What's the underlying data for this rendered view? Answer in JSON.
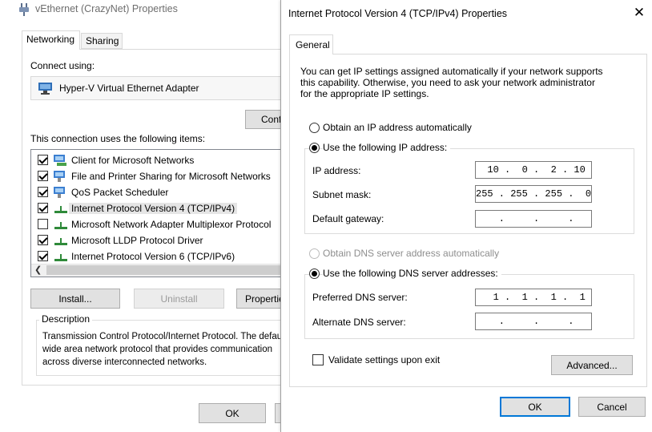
{
  "back_window": {
    "title": "vEthernet (CrazyNet) Properties",
    "tabs": [
      "Networking",
      "Sharing"
    ],
    "connect_using_label": "Connect using:",
    "adapter_name": "Hyper-V Virtual Ethernet Adapter",
    "configure_button": "Configure...",
    "items_label": "This connection uses the following items:",
    "items": [
      {
        "label": "Client for Microsoft Networks",
        "checked": true,
        "icon": "network-client-icon"
      },
      {
        "label": "File and Printer Sharing for Microsoft Networks",
        "checked": true,
        "icon": "network-service-icon"
      },
      {
        "label": "QoS Packet Scheduler",
        "checked": true,
        "icon": "network-service-icon"
      },
      {
        "label": "Internet Protocol Version 4 (TCP/IPv4)",
        "checked": true,
        "icon": "protocol-icon",
        "selected": true
      },
      {
        "label": "Microsoft Network Adapter Multiplexor Protocol",
        "checked": false,
        "icon": "protocol-icon"
      },
      {
        "label": "Microsoft LLDP Protocol Driver",
        "checked": true,
        "icon": "protocol-icon"
      },
      {
        "label": "Internet Protocol Version 6 (TCP/IPv6)",
        "checked": true,
        "icon": "protocol-icon"
      }
    ],
    "install_button": "Install...",
    "uninstall_button": "Uninstall",
    "properties_button": "Properties",
    "description_legend": "Description",
    "description_text": "Transmission Control Protocol/Internet Protocol. The default\nwide area network protocol that provides communication\nacross diverse interconnected networks.",
    "ok_button": "OK"
  },
  "dialog": {
    "title": "Internet Protocol Version 4 (TCP/IPv4) Properties",
    "close_glyph": "✕",
    "tab_general": "General",
    "intro_text": "You can get IP settings assigned automatically if your network supports\nthis capability. Otherwise, you need to ask your network administrator\nfor the appropriate IP settings.",
    "ip_auto_label": "Obtain an IP address automatically",
    "ip_manual_label": "Use the following IP address:",
    "ip_mode": "manual",
    "ip_address_label": "IP address:",
    "ip_address": " 10 .  0 .  2 . 10",
    "subnet_mask_label": "Subnet mask:",
    "subnet_mask": "255 . 255 . 255 .  0",
    "default_gateway_label": "Default gateway:",
    "default_gateway": "    .     .     .   ",
    "dns_auto_label": "Obtain DNS server address automatically",
    "dns_manual_label": "Use the following DNS server addresses:",
    "dns_mode": "manual",
    "preferred_dns_label": "Preferred DNS server:",
    "preferred_dns": "  1 .  1 .  1 .  1",
    "alternate_dns_label": "Alternate DNS server:",
    "alternate_dns": "    .     .     .   ",
    "validate_label": "Validate settings upon exit",
    "validate_checked": false,
    "advanced_button": "Advanced...",
    "ok_button": "OK",
    "cancel_button": "Cancel"
  }
}
